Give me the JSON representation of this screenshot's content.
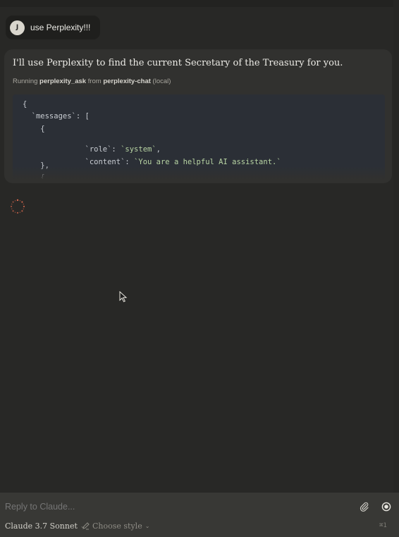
{
  "chat": {
    "user_message": {
      "avatar_initial": "J",
      "text": "use Perplexity!!!"
    },
    "assistant_message": {
      "text": "I'll use Perplexity to find the current Secretary of the Treasury for you.",
      "tool_status": {
        "prefix": "Running",
        "tool": "perplexity_ask",
        "middle": "from",
        "server": "perplexity-chat",
        "suffix": "(local)"
      },
      "code_lines": [
        "{",
        "  `messages`: [",
        "    {",
        "      `role`: ",
        "`system`",
        ",",
        "      `content`: ",
        "`You are a helpful AI assistant.`",
        "    },",
        "    {"
      ]
    },
    "loading_indicator": "spinner-icon"
  },
  "composer": {
    "placeholder": "Reply to Claude...",
    "model_label": "Claude 3.7 Sonnet",
    "style_label": "Choose style",
    "shortcut_hint": "⌘1",
    "icons": {
      "attach": "paperclip-icon",
      "record": "record-icon",
      "style": "pen-brush-icon",
      "chevron": "chevron-down-icon"
    }
  },
  "colors": {
    "background": "#282826",
    "card": "#31312f",
    "code_bg": "#2b2f36",
    "composer": "#383835",
    "spinner": "#d9694f"
  }
}
